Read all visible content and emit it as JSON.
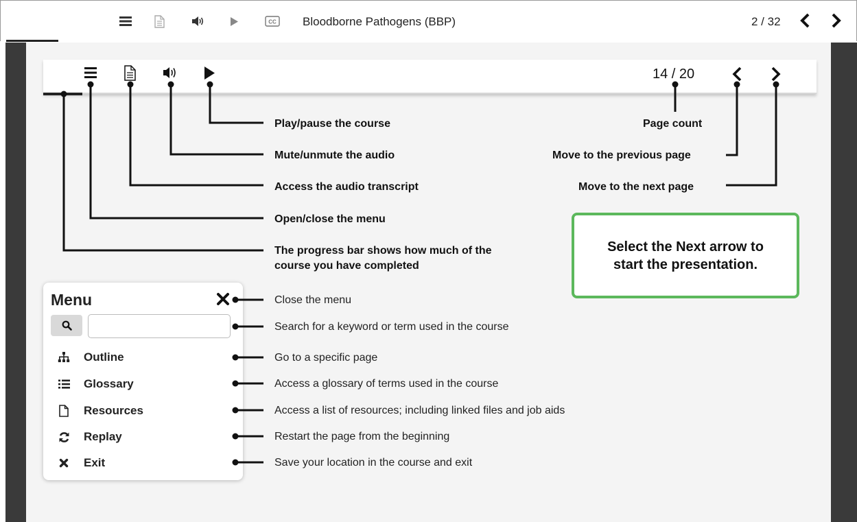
{
  "player": {
    "title": "Bloodborne Pathogens (BBP)",
    "page_indicator": "2 / 32",
    "icons": [
      "menu-icon",
      "transcript-icon",
      "audio-icon",
      "play-icon",
      "cc-icon",
      "previous-arrow-icon",
      "next-arrow-icon"
    ],
    "cc_label": "CC"
  },
  "mock_toolbar": {
    "page_count": "14 / 20"
  },
  "callouts": {
    "play": "Play/pause the course",
    "mute": "Mute/unmute the audio",
    "transcript": "Access the audio transcript",
    "menu": "Open/close the menu",
    "progress_line1": "The progress bar shows how much of the",
    "progress_line2": "course you have completed",
    "page_count": "Page count",
    "previous": "Move to the previous page",
    "next": "Move to the next page"
  },
  "instruction": {
    "line1": "Select the Next arrow to",
    "line2": "start the presentation."
  },
  "menu_panel": {
    "title": "Menu",
    "search_placeholder": "",
    "items": [
      {
        "label": "Outline",
        "icon": "sitemap-icon"
      },
      {
        "label": "Glossary",
        "icon": "list-icon"
      },
      {
        "label": "Resources",
        "icon": "document-icon"
      },
      {
        "label": "Replay",
        "icon": "replay-icon"
      },
      {
        "label": "Exit",
        "icon": "close-icon"
      }
    ]
  },
  "menu_descriptions": {
    "close": "Close the menu",
    "search": "Search for a keyword or term used in the course",
    "outline": "Go to a specific page",
    "glossary": "Access a glossary of terms used in the course",
    "resources": "Access a list of resources; including linked files and job aids",
    "replay": "Restart the page from the beginning",
    "exit": "Save your location in the course and exit"
  },
  "colors": {
    "accent_green": "#5cb85c",
    "stage_dark": "#3a3a3a",
    "slide_bg": "#f4f4f4"
  }
}
